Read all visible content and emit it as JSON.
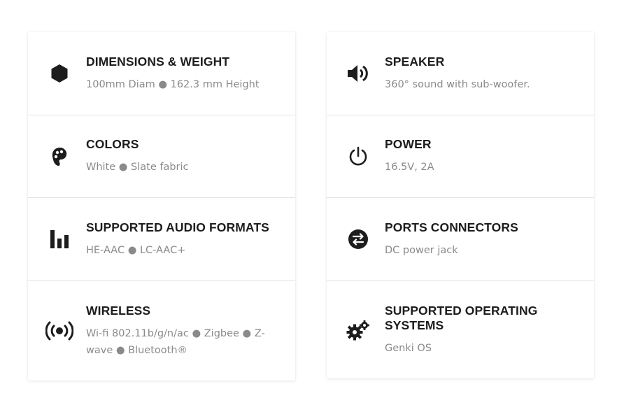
{
  "left_column": [
    {
      "icon": "hexagon-icon",
      "title": "DIMENSIONS & WEIGHT",
      "desc": "100mm Diam ● 162.3 mm Height"
    },
    {
      "icon": "palette-icon",
      "title": "COLORS",
      "desc": "White ● Slate fabric"
    },
    {
      "icon": "bar-chart-icon",
      "title": "SUPPORTED AUDIO FORMATS",
      "desc": "HE-AAC ● LC-AAC+"
    },
    {
      "icon": "broadcast-icon",
      "title": "WIRELESS",
      "desc": "Wi-fi 802.11b/g/n/ac ● Zigbee ● Z-wave ● Bluetooth®"
    }
  ],
  "right_column": [
    {
      "icon": "speaker-icon",
      "title": "SPEAKER",
      "desc": "360° sound with sub-woofer."
    },
    {
      "icon": "power-icon",
      "title": "POWER",
      "desc": "16.5V, 2A"
    },
    {
      "icon": "exchange-icon",
      "title": "PORTS CONNECTORS",
      "desc": "DC power jack"
    },
    {
      "icon": "gears-icon",
      "title": "SUPPORTED OPERATING SYSTEMS",
      "desc": "Genki OS"
    }
  ],
  "colors": {
    "title": "#1d1d1d",
    "desc": "#8a8a8a",
    "icon": "#1d1d1d",
    "divider": "#e4e4e4"
  }
}
